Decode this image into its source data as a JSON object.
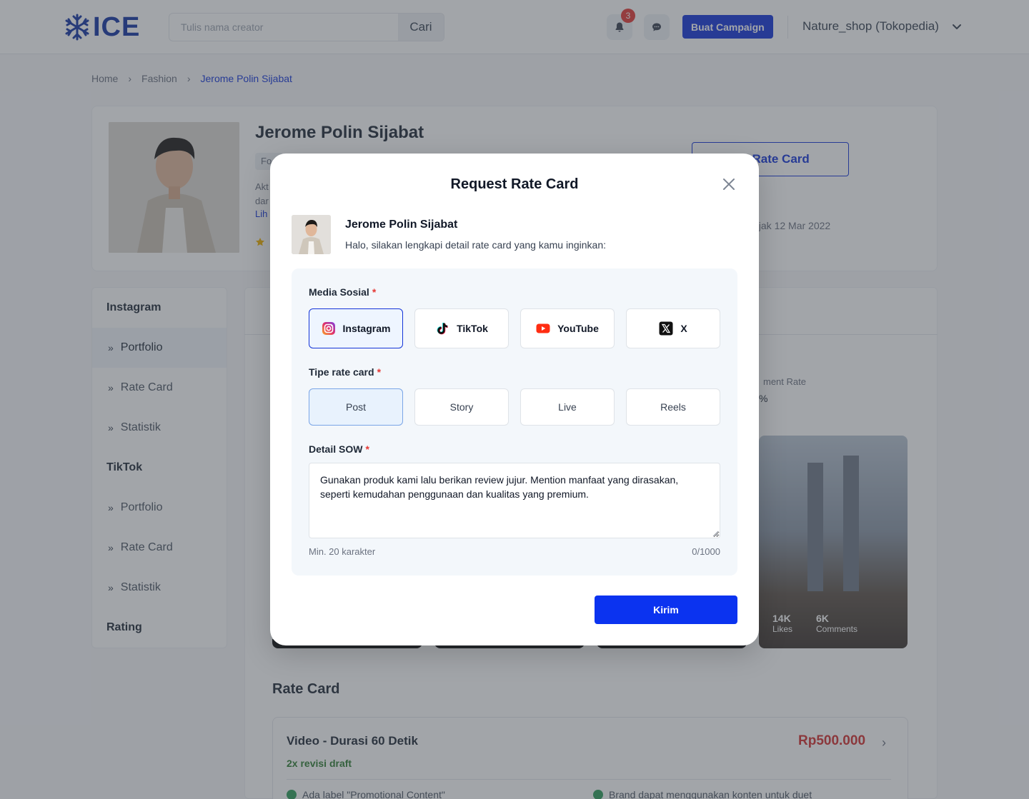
{
  "header": {
    "logo_text": "ICE",
    "search_placeholder": "Tulis nama creator",
    "search_button": "Cari",
    "notification_count": "3",
    "campaign_button": "Buat Campaign",
    "shop_name": "Nature_shop (Tokopedia)"
  },
  "breadcrumb": {
    "items": [
      "Home",
      "Fashion",
      "Jerome Polin Sijabat"
    ]
  },
  "profile": {
    "name": "Jerome Polin Sijabat",
    "chip": "Fo",
    "desc": "Akt dar",
    "more_link": "Lih",
    "rate_button": "est Rate Card",
    "since": "ejak 12 Mar 2022"
  },
  "sidebar": {
    "sections": [
      {
        "title": "Instagram",
        "items": [
          "Portfolio",
          "Rate Card",
          "Statistik"
        ]
      },
      {
        "title": "TikTok",
        "items": [
          "Portfolio",
          "Rate Card",
          "Statistik"
        ]
      },
      {
        "title": "Rating",
        "items": []
      }
    ],
    "active": "Portfolio"
  },
  "main": {
    "er_label": "ment Rate",
    "er_value": "%",
    "post": {
      "likes": "14K",
      "likes_label": "Likes",
      "comments": "6K",
      "comments_label": "Comments"
    },
    "rate_card_title": "Rate Card",
    "rate_card": {
      "name": "Video - Durasi 60 Detik",
      "price": "Rp500.000",
      "revisions": "2x revisi draft",
      "features": [
        "Ada label \"Promotional Content\"",
        "Brand dapat menggunakan konten untuk duet"
      ]
    }
  },
  "modal": {
    "title": "Request Rate Card",
    "creator_name": "Jerome Polin Sijabat",
    "subtitle": "Halo, silakan lengkapi detail rate card yang kamu inginkan:",
    "media_label": "Media Sosial",
    "media_options": [
      {
        "label": "Instagram",
        "icon": "instagram-icon",
        "selected": true
      },
      {
        "label": "TikTok",
        "icon": "tiktok-icon",
        "selected": false
      },
      {
        "label": "YouTube",
        "icon": "youtube-icon",
        "selected": false
      },
      {
        "label": "X",
        "icon": "x-icon",
        "selected": false
      }
    ],
    "type_label": "Tipe rate card",
    "type_options": [
      {
        "label": "Post",
        "selected": true
      },
      {
        "label": "Story",
        "selected": false
      },
      {
        "label": "Live",
        "selected": false
      },
      {
        "label": "Reels",
        "selected": false
      }
    ],
    "sow_label": "Detail SOW",
    "sow_value": "Gunakan produk kami lalu berikan review jujur. Mention manfaat yang dirasakan, seperti kemudahan penggunaan dan kualitas yang premium.",
    "sow_hint": "Min. 20 karakter",
    "sow_count": "0/1000",
    "submit": "Kirim",
    "required_mark": "*"
  },
  "colors": {
    "primary": "#1434d8",
    "submit": "#0b33f0",
    "required": "#e53935",
    "price": "#d32f2f"
  }
}
